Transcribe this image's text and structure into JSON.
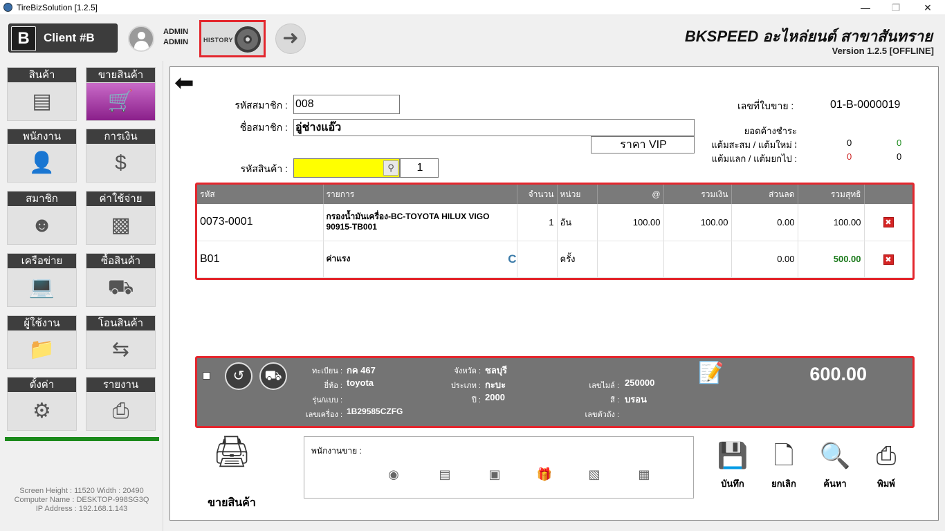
{
  "window": {
    "title": "TireBizSolution  [1.2.5]"
  },
  "header": {
    "client_letter": "B",
    "client_name": "Client #B",
    "user_line1": "ADMIN",
    "user_line2": "ADMIN",
    "history_label": "HISTORY",
    "brand": "BKSPEED อะไหล่ยนต์ สาขาสันทราย",
    "version": "Version 1.2.5 [OFFLINE]"
  },
  "sidebar": {
    "tiles": [
      {
        "label": "สินค้า",
        "icon": "barcode-box-icon"
      },
      {
        "label": "ขายสินค้า",
        "icon": "shopping-cart-icon"
      },
      {
        "label": "พนักงาน",
        "icon": "employee-icon"
      },
      {
        "label": "การเงิน",
        "icon": "money-bag-icon"
      },
      {
        "label": "สมาชิก",
        "icon": "member-icon"
      },
      {
        "label": "ค่าใช้จ่าย",
        "icon": "wallet-icon"
      },
      {
        "label": "เครือข่าย",
        "icon": "laptop-icon"
      },
      {
        "label": "ซื้อสินค้า",
        "icon": "hand-truck-icon"
      },
      {
        "label": "ผู้ใช้งาน",
        "icon": "user-folder-icon"
      },
      {
        "label": "โอนสินค้า",
        "icon": "transfer-arrows-icon"
      },
      {
        "label": "ตั้งค่า",
        "icon": "gear-icon"
      },
      {
        "label": "รายงาน",
        "icon": "printer-icon"
      }
    ],
    "screen_info": "Screen Height : 11520 Width : 20490",
    "computer_name": "Computer Name : DESKTOP-998SG3Q",
    "ip_address": "IP Address : 192.168.1.143"
  },
  "form": {
    "member_code_label": "รหัสสมาชิก :",
    "member_code": "008",
    "member_name_label": "ชื่อสมาชิก :",
    "member_name": "อู่ช่างแอ๊ว",
    "price_level": "ราคา VIP",
    "product_code_label": "รหัสสินค้า :",
    "product_code": "",
    "quantity": "1",
    "invoice_label": "เลขที่ใบขาย :",
    "invoice_no": "01-B-0000019",
    "outstanding_label": "ยอดค้างชำระ :",
    "points_label": "แต้มสะสม / แต้มใหม่ :",
    "points_accum": "0",
    "points_new": "0",
    "redeem_label": "แต้มแลก / แต้มยกไป :",
    "points_redeem": "0",
    "points_carry": "0"
  },
  "table": {
    "headers": [
      "รหัส",
      "รายการ",
      "จำนวน",
      "หน่วย",
      "@",
      "รวมเงิน",
      "ส่วนลด",
      "รวมสุทธิ",
      ""
    ],
    "rows": [
      {
        "code": "0073-0001",
        "desc": "กรองน้ำมันเครื่อง-BC-TOYOTA HILUX VIGO 90915-TB001",
        "flag": "",
        "qty": "1",
        "unit": "อัน",
        "price": "100.00",
        "amount": "100.00",
        "discount": "0.00",
        "net": "100.00"
      },
      {
        "code": "B01",
        "desc": "ค่าแรง",
        "flag": "C",
        "qty": "",
        "unit": "ครั้ง",
        "price": "",
        "amount": "",
        "discount": "0.00",
        "net": "500.00"
      }
    ]
  },
  "vehicle": {
    "plate_label": "ทะเบียน :",
    "plate": "กค 467",
    "province_label": "จังหวัด :",
    "province": "ชลบุรี",
    "brand_label": "ยี่ห้อ :",
    "brand": "toyota",
    "type_label": "ประเภท :",
    "type": "กะบะ",
    "mileage_label": "เลขไมล์ :",
    "mileage": "250000",
    "model_label": "รุ่น/แบบ :",
    "model": "",
    "year_label": "ปี :",
    "year": "2000",
    "color_label": "สี :",
    "color": "บรอน",
    "engine_label": "เลขเครื่อง :",
    "engine": "1B29585CZFG",
    "chassis_label": "เลขตัวถัง :",
    "chassis": "",
    "total": "600.00"
  },
  "bottom": {
    "pos_label": "ขายสินค้า",
    "salesperson_label": "พนักงานขาย :",
    "save_label": "บันทึก",
    "cancel_label": "ยกเลิก",
    "search_label": "ค้นหา",
    "print_label": "พิมพ์"
  },
  "colors": {
    "highlight_red": "#e3262d",
    "active_tile": "#8a1f8a",
    "net_green": "#1c7a1c",
    "search_yellow": "#ffff00"
  }
}
